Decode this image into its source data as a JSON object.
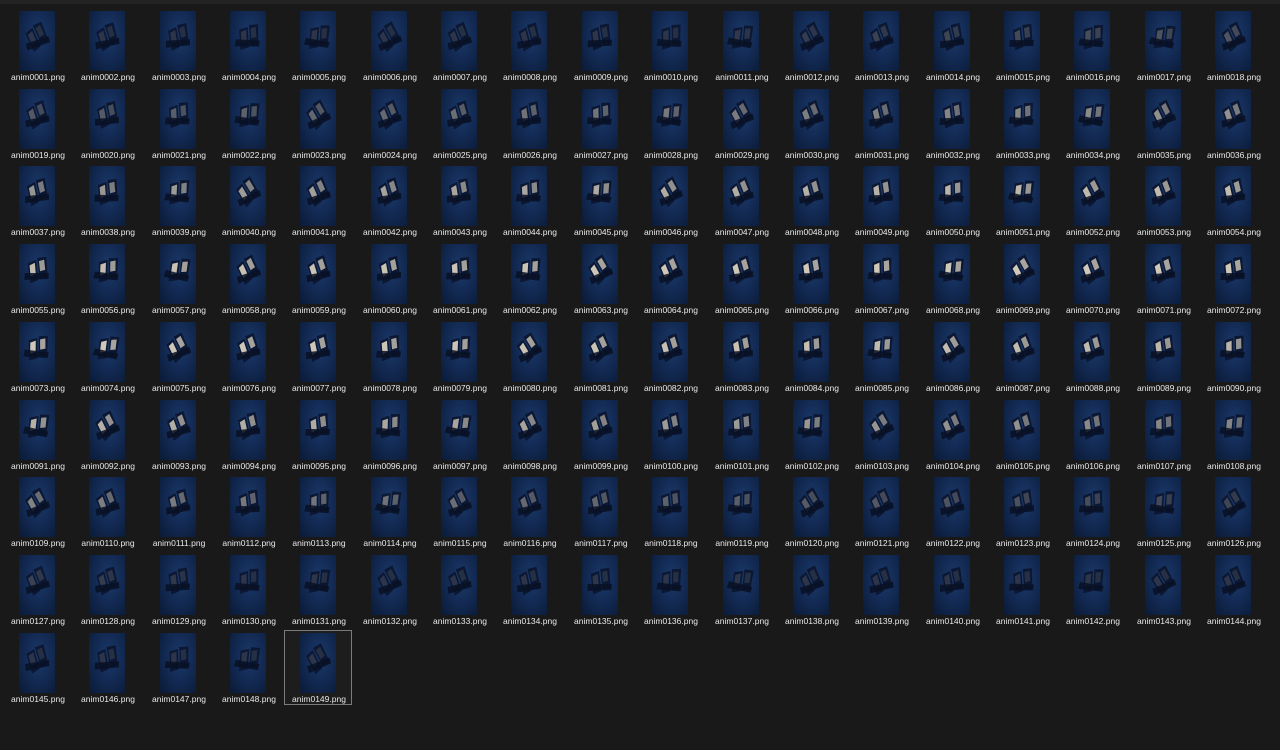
{
  "window": {
    "view": "large-icons",
    "selected_file": "anim0149.png"
  },
  "files": [
    "anim0001.png",
    "anim0002.png",
    "anim0003.png",
    "anim0004.png",
    "anim0005.png",
    "anim0006.png",
    "anim0007.png",
    "anim0008.png",
    "anim0009.png",
    "anim0010.png",
    "anim0011.png",
    "anim0012.png",
    "anim0013.png",
    "anim0014.png",
    "anim0015.png",
    "anim0016.png",
    "anim0017.png",
    "anim0018.png",
    "anim0019.png",
    "anim0020.png",
    "anim0021.png",
    "anim0022.png",
    "anim0023.png",
    "anim0024.png",
    "anim0025.png",
    "anim0026.png",
    "anim0027.png",
    "anim0028.png",
    "anim0029.png",
    "anim0030.png",
    "anim0031.png",
    "anim0032.png",
    "anim0033.png",
    "anim0034.png",
    "anim0035.png",
    "anim0036.png",
    "anim0037.png",
    "anim0038.png",
    "anim0039.png",
    "anim0040.png",
    "anim0041.png",
    "anim0042.png",
    "anim0043.png",
    "anim0044.png",
    "anim0045.png",
    "anim0046.png",
    "anim0047.png",
    "anim0048.png",
    "anim0049.png",
    "anim0050.png",
    "anim0051.png",
    "anim0052.png",
    "anim0053.png",
    "anim0054.png",
    "anim0055.png",
    "anim0056.png",
    "anim0057.png",
    "anim0058.png",
    "anim0059.png",
    "anim0060.png",
    "anim0061.png",
    "anim0062.png",
    "anim0063.png",
    "anim0064.png",
    "anim0065.png",
    "anim0066.png",
    "anim0067.png",
    "anim0068.png",
    "anim0069.png",
    "anim0070.png",
    "anim0071.png",
    "anim0072.png",
    "anim0073.png",
    "anim0074.png",
    "anim0075.png",
    "anim0076.png",
    "anim0077.png",
    "anim0078.png",
    "anim0079.png",
    "anim0080.png",
    "anim0081.png",
    "anim0082.png",
    "anim0083.png",
    "anim0084.png",
    "anim0085.png",
    "anim0086.png",
    "anim0087.png",
    "anim0088.png",
    "anim0089.png",
    "anim0090.png",
    "anim0091.png",
    "anim0092.png",
    "anim0093.png",
    "anim0094.png",
    "anim0095.png",
    "anim0096.png",
    "anim0097.png",
    "anim0098.png",
    "anim0099.png",
    "anim0100.png",
    "anim0101.png",
    "anim0102.png",
    "anim0103.png",
    "anim0104.png",
    "anim0105.png",
    "anim0106.png",
    "anim0107.png",
    "anim0108.png",
    "anim0109.png",
    "anim0110.png",
    "anim0111.png",
    "anim0112.png",
    "anim0113.png",
    "anim0114.png",
    "anim0115.png",
    "anim0116.png",
    "anim0117.png",
    "anim0118.png",
    "anim0119.png",
    "anim0120.png",
    "anim0121.png",
    "anim0122.png",
    "anim0123.png",
    "anim0124.png",
    "anim0125.png",
    "anim0126.png",
    "anim0127.png",
    "anim0128.png",
    "anim0129.png",
    "anim0130.png",
    "anim0131.png",
    "anim0132.png",
    "anim0133.png",
    "anim0134.png",
    "anim0135.png",
    "anim0136.png",
    "anim0137.png",
    "anim0138.png",
    "anim0139.png",
    "anim0140.png",
    "anim0141.png",
    "anim0142.png",
    "anim0143.png",
    "anim0144.png",
    "anim0145.png",
    "anim0146.png",
    "anim0147.png",
    "anim0148.png",
    "anim0149.png"
  ],
  "colors": {
    "background": "#191919",
    "label_text": "#e8e8e8",
    "thumbnail_blue": "#132b55",
    "selection_border": "#7b7b7b"
  }
}
